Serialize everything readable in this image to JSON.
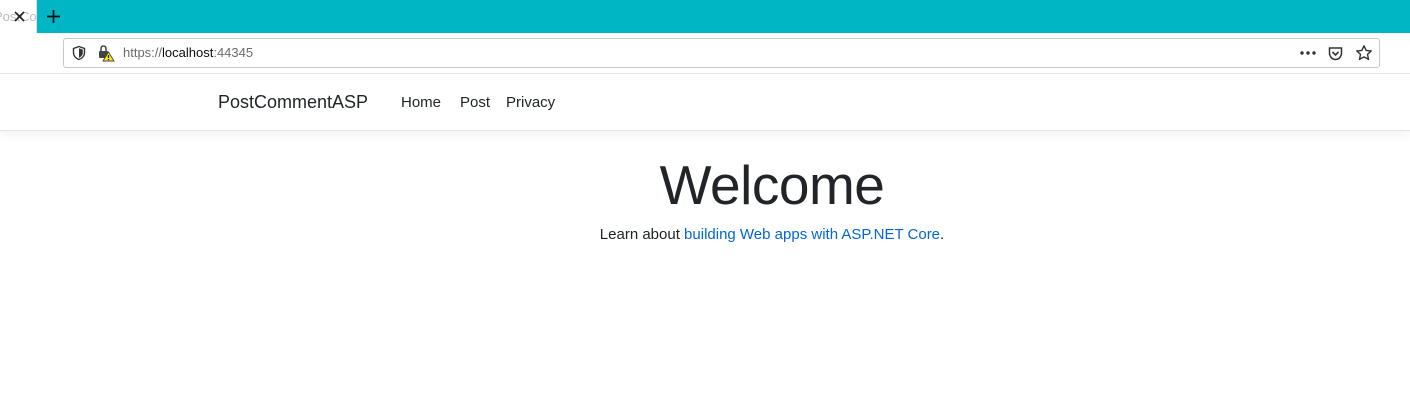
{
  "browser": {
    "tab": {
      "title": "PostCommentASP"
    },
    "url": {
      "scheme": "https://",
      "host": "localhost",
      "port": ":44345"
    }
  },
  "site": {
    "brand": "PostCommentASP",
    "nav": [
      {
        "label": "Home"
      },
      {
        "label": "Post"
      },
      {
        "label": "Privacy"
      }
    ]
  },
  "main": {
    "heading": "Welcome",
    "lead_prefix": "Learn about ",
    "lead_link": "building Web apps with ASP.NET Core",
    "lead_suffix": "."
  },
  "colors": {
    "tabstrip": "#00b5c4",
    "link": "#0366d6",
    "text": "#212529"
  }
}
